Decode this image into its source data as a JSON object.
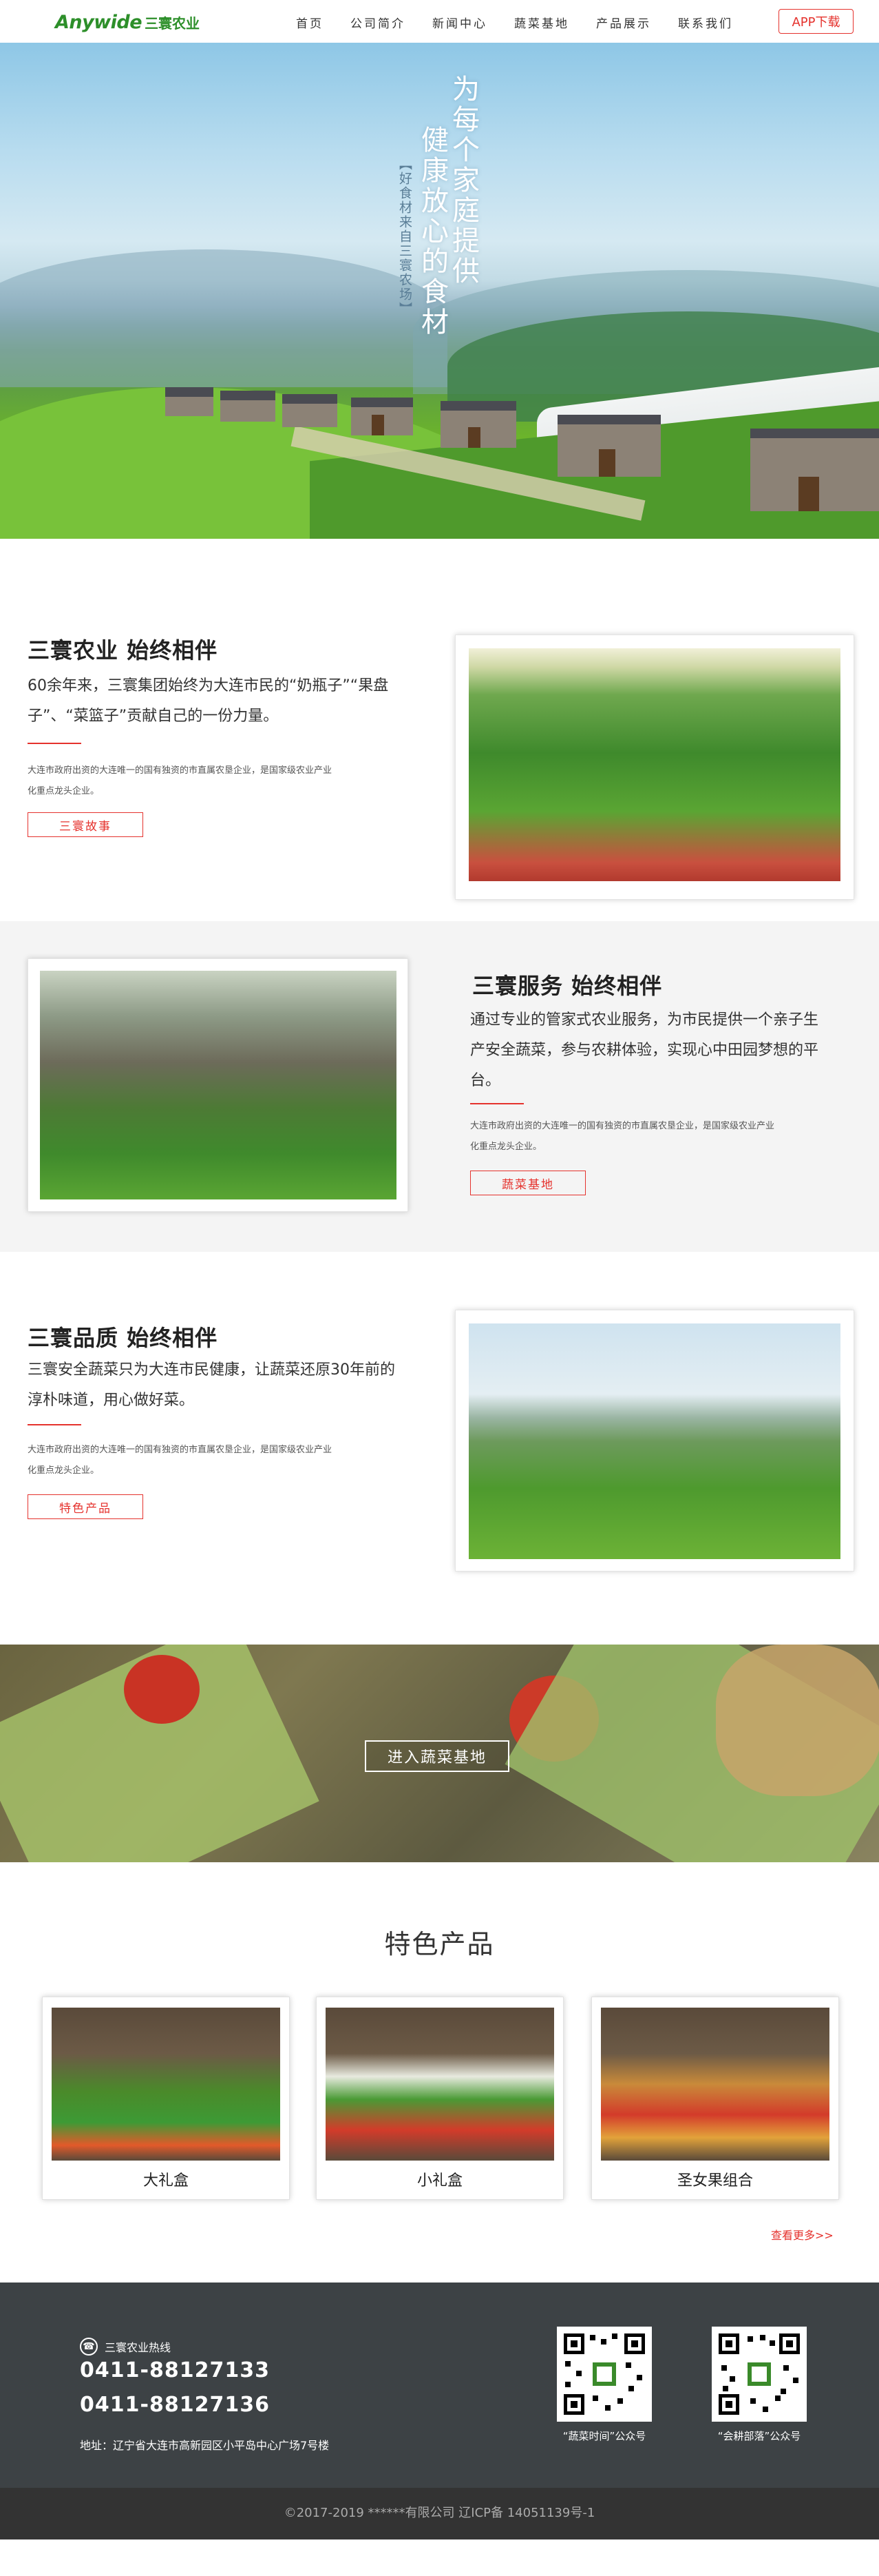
{
  "header": {
    "logo_latin": "Anywide",
    "logo_cn": "三寰农业",
    "nav": [
      "首页",
      "公司简介",
      "新闻中心",
      "蔬菜基地",
      "产品展示",
      "联系我们"
    ],
    "app_button": "APP下载"
  },
  "hero": {
    "title_line1": "为每个家庭提供",
    "title_line2": "健康放心的食材",
    "subtitle": "【好食材来自三寰农场】"
  },
  "sections": [
    {
      "title": "三寰农业 始终相伴",
      "desc": "60余年来，三寰集团始终为大连市民的“奶瓶子”“果盘子”、“菜篮子”贡献自己的一份力量。",
      "small": "大连市政府出资的大连唯一的国有独资的市直属农垦企业，是国家级农业产业化重点龙头企业。",
      "button": "三寰故事"
    },
    {
      "title": "三寰服务 始终相伴",
      "desc": "通过专业的管家式农业服务，为市民提供一个亲子生产安全蔬菜，参与农耕体验，实现心中田园梦想的平台。",
      "small": "大连市政府出资的大连唯一的国有独资的市直属农垦企业，是国家级农业产业化重点龙头企业。",
      "button": "蔬菜基地"
    },
    {
      "title": "三寰品质 始终相伴",
      "desc": "三寰安全蔬菜只为大连市民健康，让蔬菜还原30年前的淳朴味道，用心做好菜。",
      "small": "大连市政府出资的大连唯一的国有独资的市直属农垦企业，是国家级农业产业化重点龙头企业。",
      "button": "特色产品"
    }
  ],
  "banner": {
    "button": "进入蔬菜基地"
  },
  "products": {
    "title": "特色产品",
    "items": [
      {
        "name": "大礼盒"
      },
      {
        "name": "小礼盒"
      },
      {
        "name": "圣女果组合"
      }
    ],
    "more": "查看更多>>"
  },
  "footer": {
    "hotline_label": "三寰农业热线",
    "phone1": "0411-88127133",
    "phone2": "0411-88127136",
    "address": "地址：辽宁省大连市高新园区小平岛中心广场7号楼",
    "qr1_caption": "“蔬菜时间”公众号",
    "qr2_caption": "“会耕部落”公众号",
    "copyright": "©2017-2019 ******有限公司   辽ICP备 14051139号-1"
  },
  "colors": {
    "brand_green": "#2d8f2a",
    "accent_red": "#e5322d",
    "footer_bg": "#3d4245"
  }
}
